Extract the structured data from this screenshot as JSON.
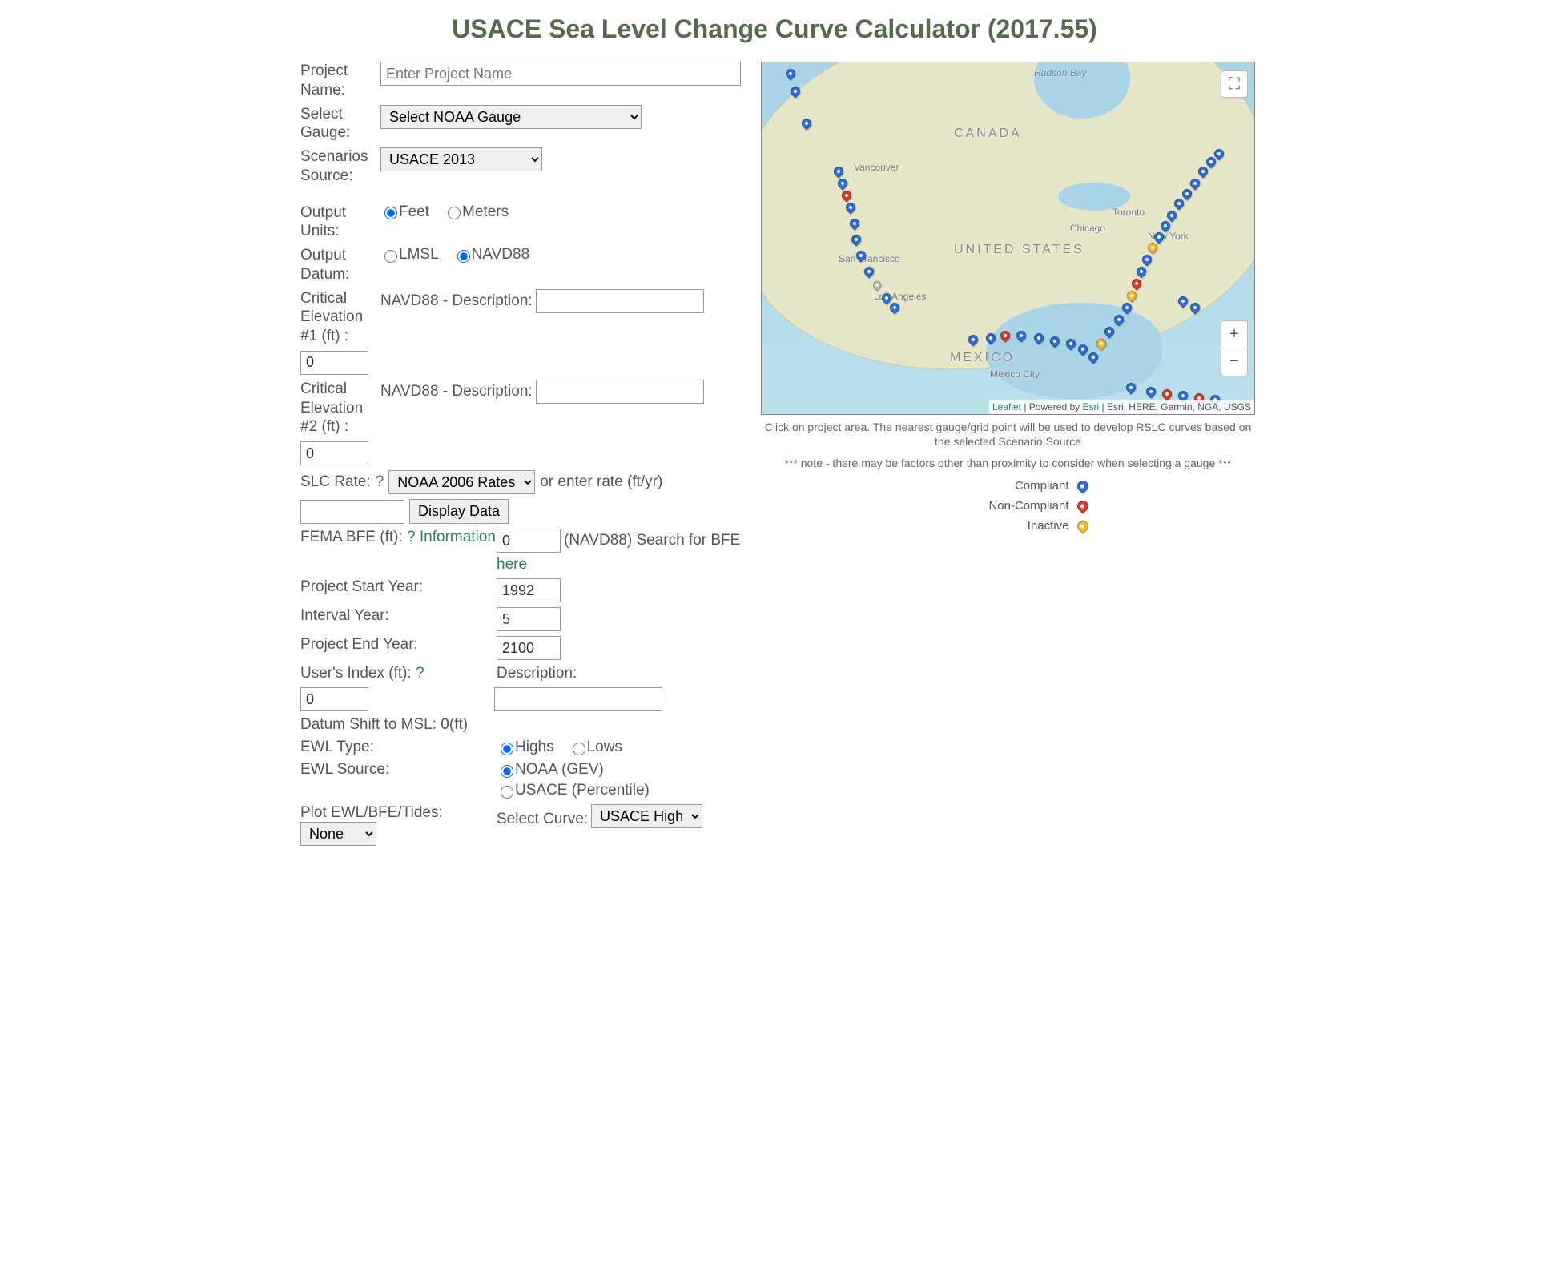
{
  "title": "USACE Sea Level Change Curve Calculator (2017.55)",
  "form": {
    "projectName": {
      "label": "Project Name:",
      "placeholder": "Enter Project Name",
      "value": ""
    },
    "selectGauge": {
      "label": "Select Gauge:",
      "value": "Select NOAA Gauge"
    },
    "scenariosSource": {
      "label": "Scenarios Source:",
      "value": "USACE 2013"
    },
    "outputUnits": {
      "label": "Output Units:",
      "options": [
        "Feet",
        "Meters"
      ],
      "selected": "Feet"
    },
    "outputDatum": {
      "label": "Output Datum:",
      "options": [
        "LMSL",
        "NAVD88"
      ],
      "selected": "NAVD88"
    },
    "criticalElev1": {
      "label": "Critical Elevation #1 (ft) :",
      "value": "0",
      "descLabel": "NAVD88 - Description:",
      "descValue": ""
    },
    "criticalElev2": {
      "label": "Critical Elevation #2 (ft) :",
      "value": "0",
      "descLabel": "NAVD88 - Description:",
      "descValue": ""
    },
    "slcRate": {
      "label": "SLC Rate:",
      "help": "?",
      "selectValue": "NOAA 2006 Rates",
      "orEnter": "or enter rate (ft/yr)",
      "rateValue": "",
      "displayBtn": "Display Data"
    },
    "femaBFE": {
      "label": "FEMA BFE (ft): ",
      "help": "?",
      "value": "0",
      "suffix": "(NAVD88) Search for BFE ",
      "link1": "Information",
      "link2": "here"
    },
    "projectStartYear": {
      "label": "Project Start Year:",
      "value": "1992"
    },
    "intervalYear": {
      "label": "Interval Year:",
      "value": "5"
    },
    "projectEndYear": {
      "label": "Project End Year:",
      "value": "2100"
    },
    "usersIndex": {
      "label": "User's Index (ft): ",
      "help": "?",
      "value": "0",
      "descLabel": "Description:",
      "descValue": ""
    },
    "datumShift": {
      "label": "Datum Shift to MSL: 0(ft)"
    },
    "ewlType": {
      "label": "EWL Type:",
      "options": [
        "Highs",
        "Lows"
      ],
      "selected": "Highs"
    },
    "ewlSource": {
      "label": "EWL Source:",
      "options": [
        "NOAA (GEV)",
        "USACE (Percentile)"
      ],
      "selected": "NOAA (GEV)"
    },
    "plotEWL": {
      "label": "Plot EWL/BFE/Tides:",
      "value": "None"
    },
    "selectCurve": {
      "label": "Select Curve:",
      "value": "USACE High"
    }
  },
  "map": {
    "labels": {
      "hudson": "Hudson Bay",
      "canada": "CANADA",
      "vancouver": "Vancouver",
      "toronto": "Toronto",
      "chicago": "Chicago",
      "newyork": "New York",
      "us": "UNITED STATES",
      "sf": "San Francisco",
      "la": "Los Angeles",
      "mexico": "MEXICO",
      "mexicocity": "Mexico City"
    },
    "attribution": {
      "leaflet": "Leaflet",
      "powered": " | Powered by ",
      "esri": "Esri",
      "rest": " | Esri, HERE, Garmin, NGA, USGS"
    },
    "caption": "Click on project area. The nearest gauge/grid point will be used to develop RSLC curves based on the selected Scenario Source",
    "note": "*** note - there may be factors other than proximity to consider when selecting a gauge ***",
    "legend": {
      "compliant": "Compliant",
      "noncompliant": "Non-Compliant",
      "inactive": "Inactive"
    }
  }
}
